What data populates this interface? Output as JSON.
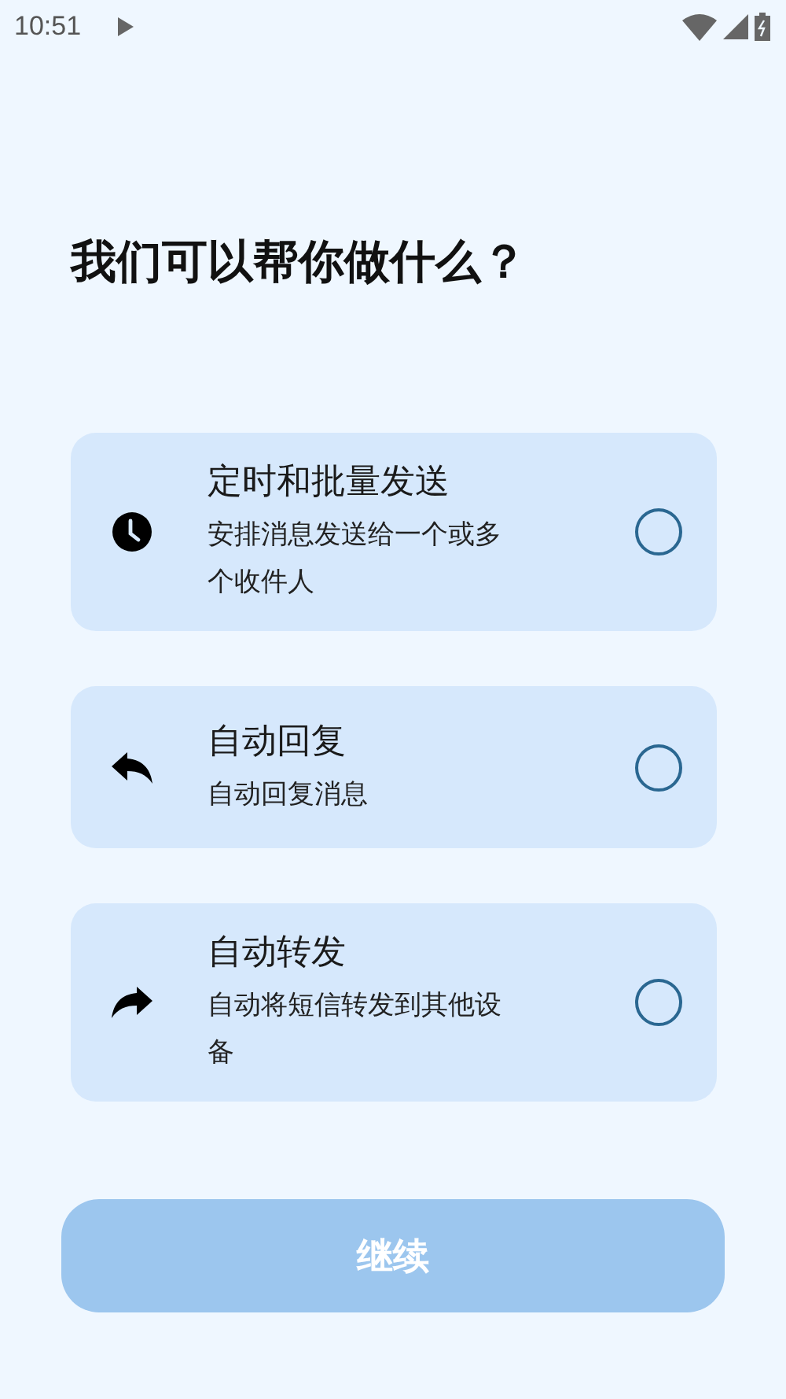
{
  "status_bar": {
    "time": "10:51"
  },
  "title": "我们可以帮你做什么？",
  "options": [
    {
      "kind": "clock",
      "title": "定时和批量发送",
      "description": "安排消息发送给一个或多个收件人",
      "selected": false
    },
    {
      "kind": "reply",
      "title": "自动回复",
      "description": "自动回复消息",
      "selected": false
    },
    {
      "kind": "forward",
      "title": "自动转发",
      "description": "自动将短信转发到其他设备",
      "selected": false
    }
  ],
  "continue_button": {
    "label": "继续",
    "disabled": true
  }
}
